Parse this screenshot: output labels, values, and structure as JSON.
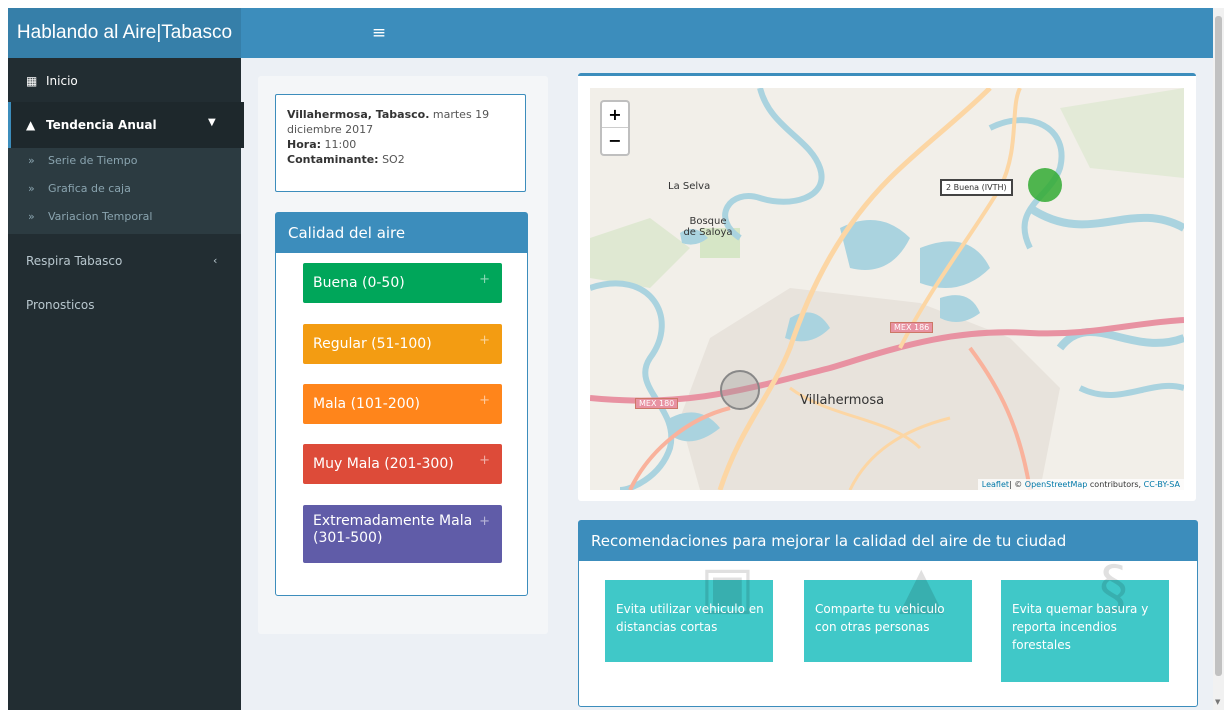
{
  "header": {
    "title": "Hablando al Aire|Tabasco",
    "menu_icon": "hamburger-icon"
  },
  "sidebar": {
    "inicio": "Inicio",
    "tendencia": "Tendencia Anual",
    "submenu": [
      "Serie de Tiempo",
      "Grafica de caja",
      "Variacion Temporal"
    ],
    "respira": "Respira Tabasco",
    "pronosticos": "Pronosticos"
  },
  "info": {
    "city": "Villahermosa, Tabasco.",
    "date": "martes 19 diciembre 2017",
    "hora_label": "Hora:",
    "hora_value": "11:00",
    "cont_label": "Contaminante:",
    "cont_value": "SO2"
  },
  "air_quality": {
    "title": "Calidad del aire",
    "categories": [
      {
        "label": "Buena (0-50)",
        "color": "#00a65a"
      },
      {
        "label": "Regular (51-100)",
        "color": "#f39c12"
      },
      {
        "label": "Mala (101-200)",
        "color": "#ff851b"
      },
      {
        "label": "Muy Mala (201-300)",
        "color": "#dd4b39"
      },
      {
        "label": "Extremadamente Mala (301-500)",
        "color": "#605ca8"
      }
    ]
  },
  "map": {
    "zoom_in": "+",
    "zoom_out": "−",
    "tooltip": "2 Buena (IVTH)",
    "labels": {
      "la_selva": "La Selva",
      "bosque": "Bosque de Saloya",
      "villahermosa": "Villahermosa",
      "mex186": "MEX 186",
      "mex180": "MEX 180"
    },
    "attribution_leaflet": "Leaflet",
    "attribution_sep": "| © ",
    "attribution_osm": "OpenStreetMap",
    "attribution_mid": " contributors, ",
    "attribution_license": "CC-BY-SA"
  },
  "recommendations": {
    "title": "Recomendaciones para mejorar la calidad del aire de tu ciudad",
    "items": [
      "Evita utilizar vehiculo en distancias cortas",
      "Comparte tu vehiculo con otras personas",
      "Evita quemar basura y reporta incendios forestales"
    ]
  }
}
